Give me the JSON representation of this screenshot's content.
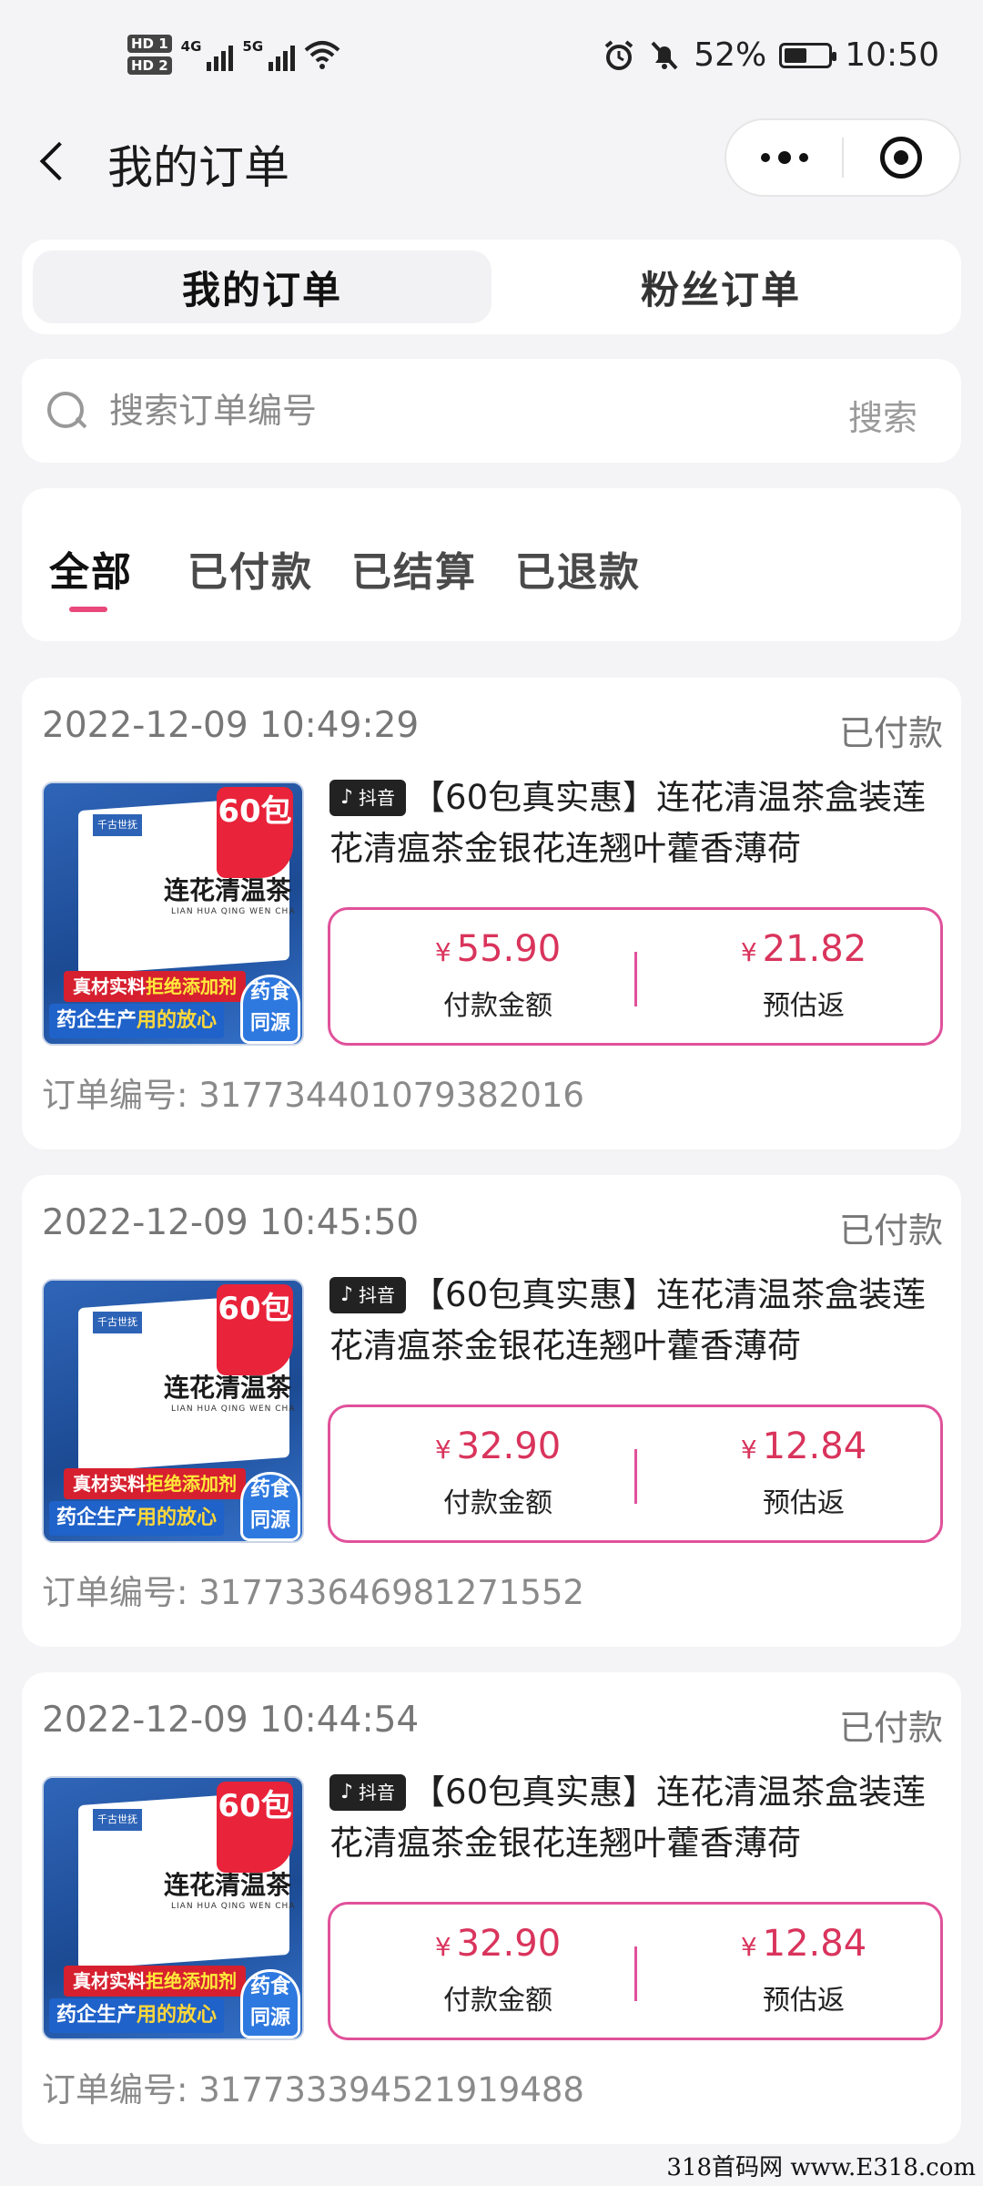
{
  "status_bar": {
    "sim1": "HD 1",
    "sim2": "HD 2",
    "net1": "4G",
    "net2": "5G",
    "battery_percent": "52%",
    "battery_level": 0.52,
    "time": "10:50"
  },
  "nav": {
    "title": "我的订单"
  },
  "segments": [
    "我的订单",
    "粉丝订单"
  ],
  "search": {
    "placeholder": "搜索订单编号",
    "value": "",
    "button": "搜索"
  },
  "filters": [
    "全部",
    "已付款",
    "已结算",
    "已退款"
  ],
  "product_image": {
    "brand": "千古世抚",
    "badge": "60包",
    "name": "连花清温茶",
    "pinyin": "LIAN HUA QING WEN CHA",
    "ribbon1_a": "真材实料",
    "ribbon1_b": "拒绝添加剂",
    "ribbon2_a": "药企生产",
    "ribbon2_b": "用的放心",
    "seal": "药食同源"
  },
  "platform_tag": {
    "icon": "douyin-icon",
    "label": "抖音"
  },
  "labels": {
    "pay_amount": "付款金额",
    "estimated_rebate": "预估返",
    "order_no_prefix": "订单编号:",
    "currency": "¥"
  },
  "orders": [
    {
      "time": "2022-12-09 10:49:29",
      "status": "已付款",
      "title": "【60包真实惠】连花清温茶盒装莲花清瘟茶金银花连翘叶藿香薄荷",
      "pay": "55.90",
      "rebate": "21.82",
      "order_no": "3177344010793820​16"
    },
    {
      "time": "2022-12-09 10:45:50",
      "status": "已付款",
      "title": "【60包真实惠】连花清温茶盒装莲花清瘟茶金银花连翘叶藿香薄荷",
      "pay": "32.90",
      "rebate": "12.84",
      "order_no": "317733646981271552"
    },
    {
      "time": "2022-12-09 10:44:54",
      "status": "已付款",
      "title": "【60包真实惠】连花清温茶盒装莲花清瘟茶金银花连翘叶藿香薄荷",
      "pay": "32.90",
      "rebate": "12.84",
      "order_no": "317733394521919488"
    }
  ],
  "watermark": "318首码网 www.E318.com"
}
